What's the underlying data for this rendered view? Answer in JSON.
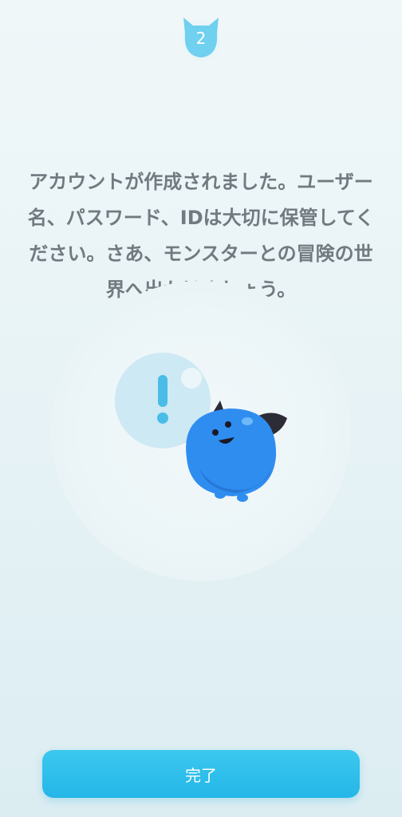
{
  "step": {
    "number": "2",
    "icon": "creature-badge-icon"
  },
  "message": {
    "text": "アカウントが作成されました。ユーザー\n名、パスワード、IDは大切に保管してく\nださい。さあ、モンスターとの冒険の世\n界へ出かけましょう。"
  },
  "illustration": {
    "bubble_icon": "exclamation-icon",
    "character": "blue-monster"
  },
  "actions": {
    "complete_label": "完了"
  },
  "colors": {
    "accent": "#2ab9ea",
    "text": "#707a80",
    "monster": "#2f8df0",
    "background": "#eaf4f7"
  }
}
